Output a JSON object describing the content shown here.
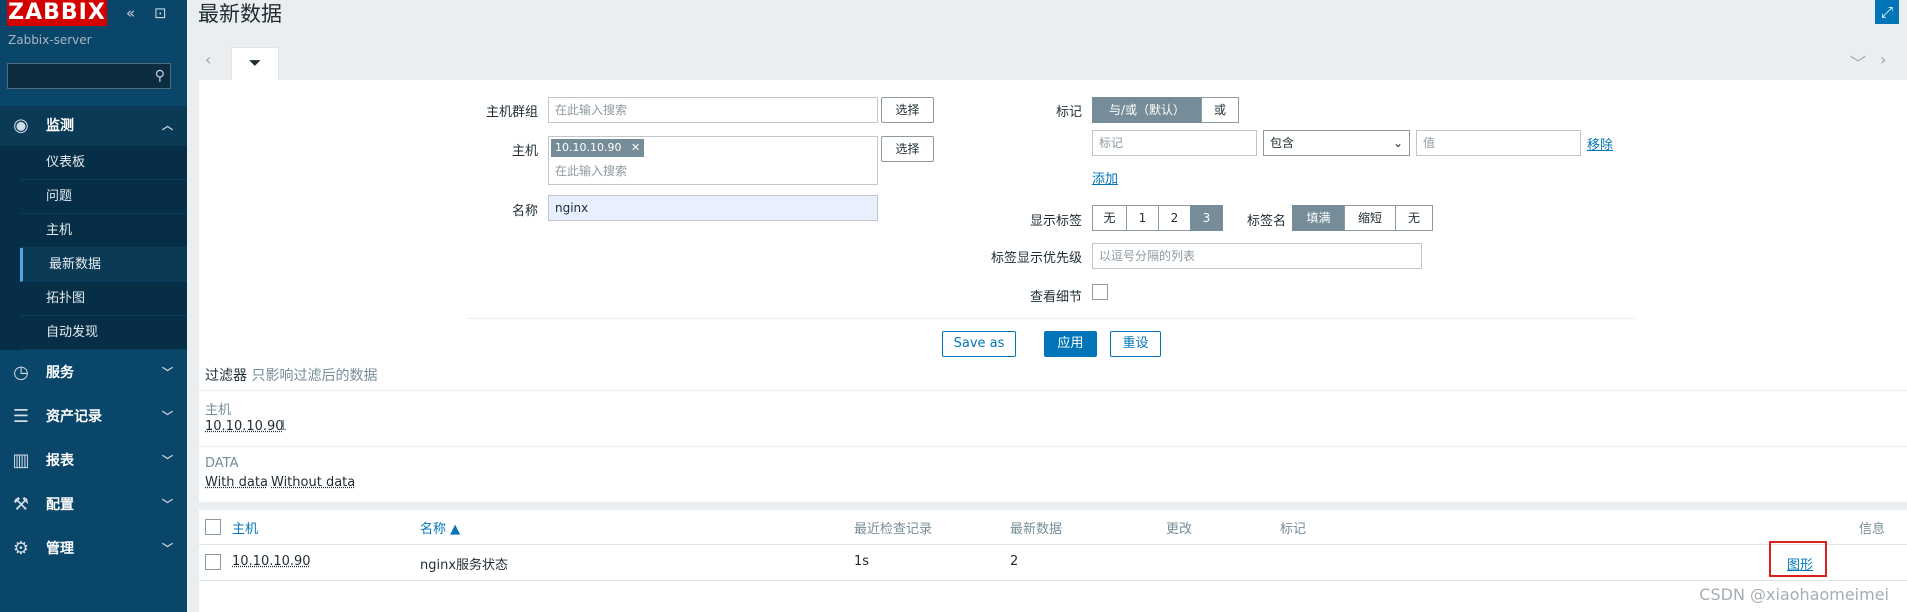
{
  "sidebar": {
    "logo": "ZABBIX",
    "server_name": "Zabbix-server",
    "search_placeholder": "",
    "menu": [
      {
        "label": "监测",
        "icon": "eye-icon"
      },
      {
        "label": "服务",
        "icon": "clock-icon"
      },
      {
        "label": "资产记录",
        "icon": "list-icon"
      },
      {
        "label": "报表",
        "icon": "bar-chart-icon"
      },
      {
        "label": "配置",
        "icon": "wrench-icon"
      },
      {
        "label": "管理",
        "icon": "gear-icon"
      }
    ],
    "submenu": [
      "仪表板",
      "问题",
      "主机",
      "最新数据",
      "拓扑图",
      "自动发现"
    ],
    "active_submenu": "最新数据"
  },
  "header": {
    "title": "最新数据"
  },
  "filter": {
    "host_group_label": "主机群组",
    "host_group_placeholder": "在此输入搜索",
    "host_label": "主机",
    "host_chip": "10.10.10.90",
    "host_placeholder": "在此输入搜索",
    "select_button": "选择",
    "name_label": "名称",
    "name_value": "nginx",
    "tags_label": "标记",
    "tag_and_or": "与/或（默认）",
    "tag_or": "或",
    "tag_placeholder": "标记",
    "tag_operator": "包含",
    "tag_value_placeholder": "值",
    "remove_link": "移除",
    "add_link": "添加",
    "show_tags_label": "显示标签",
    "show_tags_options": [
      "无",
      "1",
      "2",
      "3"
    ],
    "tag_name_label": "标签名",
    "tag_name_options": [
      "填满",
      "缩短",
      "无"
    ],
    "tag_priority_label": "标签显示优先级",
    "tag_priority_placeholder": "以逗号分隔的列表",
    "show_details_label": "查看细节",
    "save_as": "Save as",
    "apply": "应用",
    "reset": "重设"
  },
  "subfilter": {
    "title": "过滤器",
    "title_note": "只影响过滤后的数据",
    "host_label": "主机",
    "host_value": "10.10.10.90",
    "host_count": "1",
    "data_label": "DATA",
    "with_data": "With data",
    "without_data": "Without data"
  },
  "table": {
    "headers": [
      "主机",
      "名称 ▲",
      "最近检查记录",
      "最新数据",
      "更改",
      "标记",
      "信息"
    ],
    "rows": [
      {
        "host": "10.10.10.90",
        "name": "nginx服务状态",
        "last_check": "1s",
        "last_value": "2",
        "change": "",
        "tags": "",
        "action": "图形"
      }
    ]
  },
  "watermark": "CSDN @xiaohaomeimei"
}
